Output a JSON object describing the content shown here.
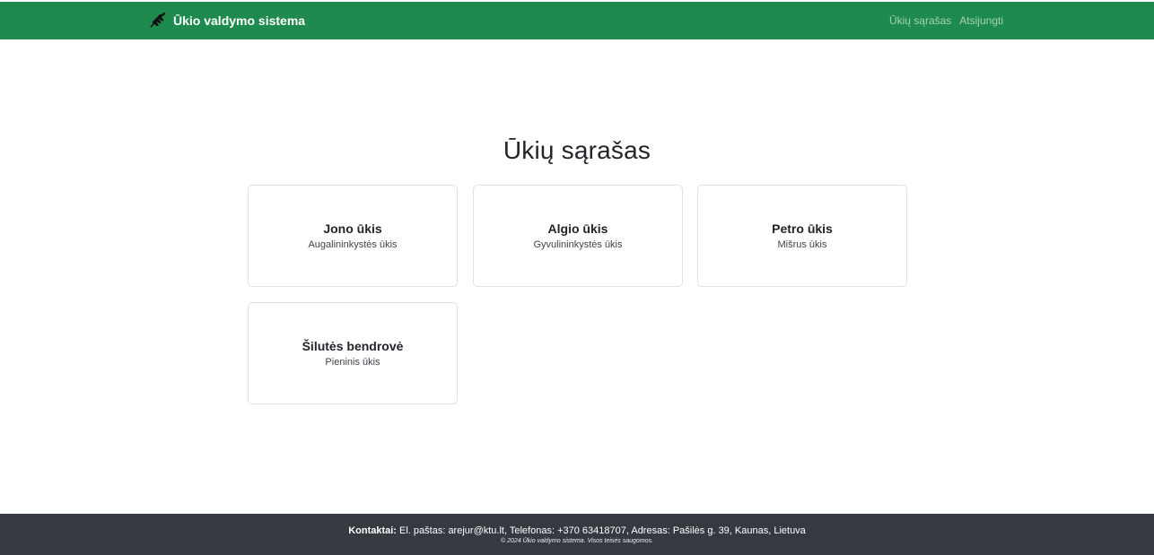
{
  "navbar": {
    "brand_icon": "wheat-icon",
    "brand_label": "Ūkio valdymo sistema",
    "links": [
      {
        "label": "Ūkių sąrašas"
      },
      {
        "label": "Atsijungti"
      }
    ],
    "background": "#1e8a4d"
  },
  "main": {
    "title": "Ūkių sąrašas",
    "farms": [
      {
        "name": "Jono ūkis",
        "type": "Augalininkystės ūkis"
      },
      {
        "name": "Algio ūkis",
        "type": "Gyvulininkystės ūkis"
      },
      {
        "name": "Petro ūkis",
        "type": "Mišrus ūkis"
      },
      {
        "name": "Šilutės bendrovė",
        "type": "Pieninis ūkis"
      }
    ]
  },
  "footer": {
    "contacts_label": "Kontaktai:",
    "contacts_text": " El. paštas: arejur@ktu.lt, Telefonas: +370 63418707, Adresas: Pašilės g. 39, Kaunas, Lietuva",
    "copyright": "© 2024 Ūkio valdymo sistema. Visos teisės saugomos.",
    "background": "#343a40"
  }
}
